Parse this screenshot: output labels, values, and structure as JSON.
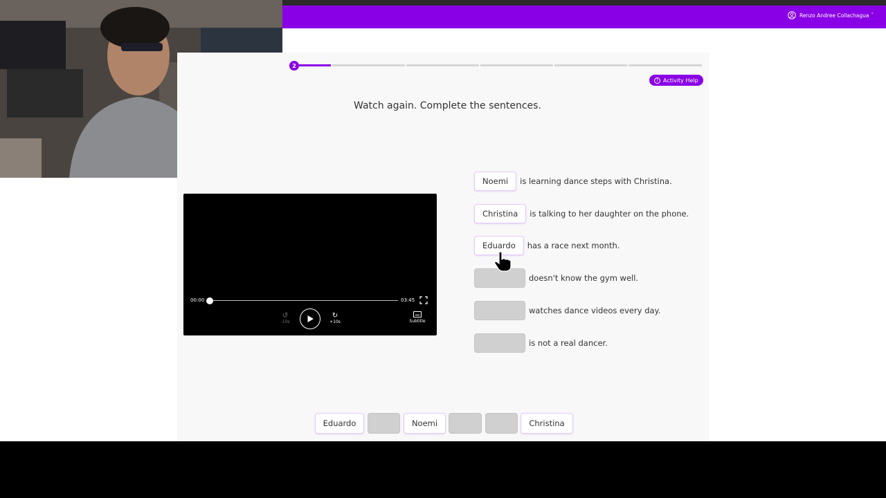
{
  "header": {
    "user_name": "Renzo Andree Collachagua",
    "caret": "˅",
    "accent": "#8a00e6"
  },
  "progress": {
    "current_step": "2",
    "total_segments": 6
  },
  "help_button": {
    "label": "Activity Help"
  },
  "instruction": "Watch again. Complete the sentences.",
  "video": {
    "current_time": "00:00",
    "duration": "03:45",
    "rewind_label": "-10s",
    "forward_label": "+10s",
    "subtitle_label": "Subtitle"
  },
  "sentences": [
    {
      "answer": "Noemi",
      "text": "is learning dance steps with Christina."
    },
    {
      "answer": "Christina",
      "text": "is talking to her daughter on the phone."
    },
    {
      "answer": "Eduardo",
      "text": "has a race next month."
    },
    {
      "answer": "",
      "text": "doesn't know the gym well."
    },
    {
      "answer": "",
      "text": "watches dance videos every day."
    },
    {
      "answer": "",
      "text": "is not a real dancer."
    }
  ],
  "word_bank": [
    "Eduardo",
    "",
    "Noemi",
    "",
    "",
    "Christina"
  ]
}
